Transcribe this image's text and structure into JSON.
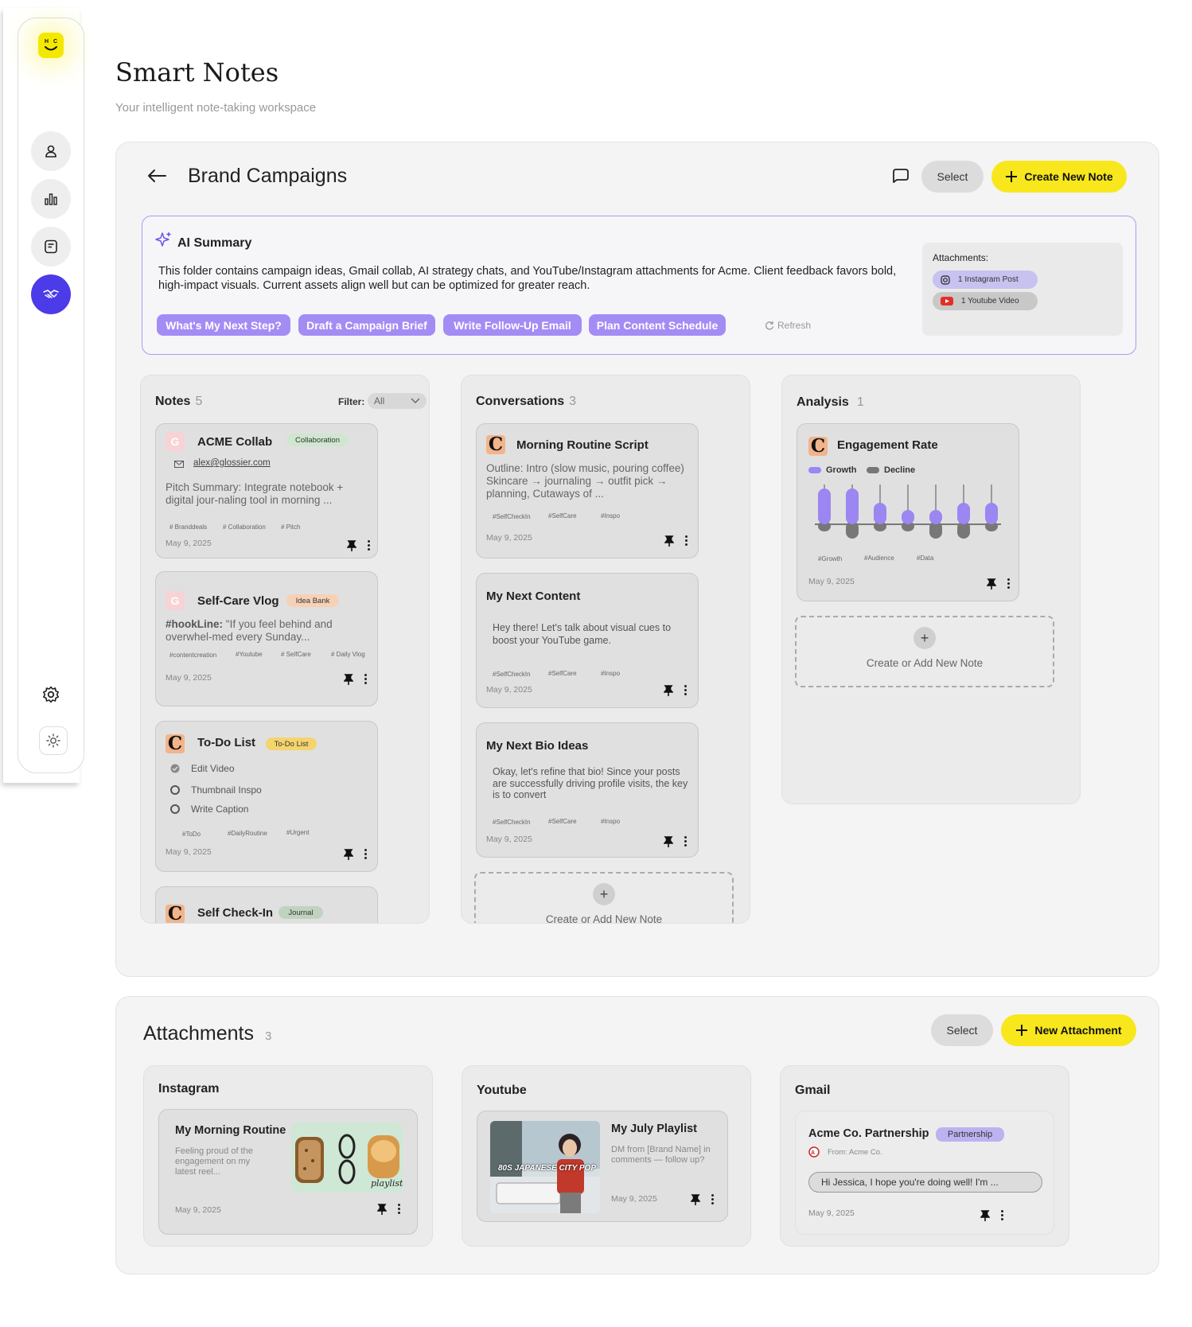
{
  "app": {
    "title": "Smart Notes",
    "subtitle": "Your intelligent note-taking workspace"
  },
  "colors": {
    "accent_yellow": "#f8e71c",
    "accent_purple": "#4b3be8",
    "chip_purple": "#a48cf5"
  },
  "sidebar": {
    "logo_icon": "smiley-logo-icon",
    "items": [
      {
        "icon": "user-icon"
      },
      {
        "icon": "bar-chart-icon"
      },
      {
        "icon": "notes-icon"
      },
      {
        "icon": "handshake-icon",
        "active": true
      }
    ],
    "bottom": [
      {
        "icon": "gear-icon"
      },
      {
        "icon": "sun-icon"
      }
    ]
  },
  "folder": {
    "title": "Brand Campaigns",
    "select_label": "Select",
    "create_label": "Create New Note"
  },
  "ai_summary": {
    "title": "AI Summary",
    "text": "This folder contains campaign ideas, Gmail collab, AI strategy chats, and YouTube/Instagram attachments for Acme. Client feedback favors bold, high-impact visuals. Current assets align well but can be optimized for greater reach.",
    "chips": [
      "What's My Next Step?",
      "Draft a Campaign Brief",
      "Write Follow-Up Email",
      "Plan Content Schedule"
    ],
    "refresh_label": "Refresh",
    "attachments_label": "Attachments:",
    "attachments": [
      "1 Instagram Post",
      "1 Youtube Video"
    ]
  },
  "notes": {
    "title": "Notes",
    "count": "5",
    "filter_label": "Filter:",
    "filter_value": "All",
    "cards": [
      {
        "title": "ACME Collab",
        "tag": "Collaboration",
        "email": "alex@glossier.com",
        "body": "Pitch Summary: Integrate notebook + digital jour-naling tool in morning ...",
        "tags": [
          "# Branddeals",
          "# Collaboration",
          "# Pitch"
        ],
        "date": "May 9, 2025"
      },
      {
        "title": "Self-Care Vlog",
        "tag": "Idea Bank",
        "hook": "#hookLine:",
        "body": "\"If you feel behind and overwhel-med every Sunday...",
        "tags": [
          "#contentcreation",
          "#Youtube",
          "# SelfCare",
          "# Daily Vlog"
        ],
        "date": "May 9, 2025"
      },
      {
        "title": "To-Do List",
        "tag": "To-Do List",
        "todos": [
          "Edit Video",
          "Thumbnail Inspo",
          "Write Caption"
        ],
        "tags": [
          "#ToDo",
          "#DailyRoutine",
          "#Urgent"
        ],
        "date": "May 9, 2025"
      },
      {
        "title": "Self Check-In",
        "tag": "Journal"
      }
    ]
  },
  "conversations": {
    "title": "Conversations",
    "count": "3",
    "cards": [
      {
        "title": "Morning Routine Script",
        "body": "Outline: Intro (slow music, pouring coffee) Skincare → journaling → outfit pick → planning, Cutaways of ...",
        "tags": [
          "#SelfCheckIn",
          "#SelfCare",
          "#Inspo"
        ],
        "date": "May 9, 2025"
      },
      {
        "title": "My Next Content",
        "body": "Hey there! Let's talk about visual cues to boost your YouTube game.",
        "tags": [
          "#SelfCheckIn",
          "#SelfCare",
          "#Inspo"
        ],
        "date": "May 9, 2025"
      },
      {
        "title": "My Next Bio Ideas",
        "body": "Okay, let's refine that bio! Since your posts are successfully driving profile visits, the key is to convert",
        "tags": [
          "#SelfCheckIn",
          "#SelfCare",
          "#Inspo"
        ],
        "date": "May 9, 2025"
      }
    ],
    "add_label": "Create or Add New Note"
  },
  "analysis": {
    "title": "Analysis",
    "count": "1",
    "card": {
      "title": "Engagement Rate",
      "legend": [
        "Growth",
        "Decline"
      ],
      "tags": [
        "#Growth",
        "#Audience",
        "#Data"
      ],
      "date": "May 9, 2025"
    },
    "add_label": "Create or Add New Note"
  },
  "chart_data": {
    "type": "bar",
    "categories": [
      "1",
      "2",
      "3",
      "4",
      "5",
      "6",
      "7"
    ],
    "series": [
      {
        "name": "Growth",
        "values": [
          5,
          5,
          3,
          2,
          2,
          3,
          3
        ]
      },
      {
        "name": "Decline",
        "values": [
          -1,
          -2,
          -1,
          -1,
          -2,
          -2,
          -1
        ]
      }
    ],
    "xlabel": "",
    "ylabel": "",
    "grid": false,
    "legend": "top-left"
  },
  "attachments": {
    "title": "Attachments",
    "count": "3",
    "select_label": "Select",
    "new_label": "New Attachment",
    "instagram": {
      "header": "Instagram",
      "title": "My Morning Routine",
      "body": "Feeling proud of the engagement on my latest reel...",
      "date": "May 9, 2025",
      "thumb_caption": "playlist"
    },
    "youtube": {
      "header": "Youtube",
      "title": "My July Playlist",
      "body": "DM from [Brand Name] in comments — follow up?",
      "date": "May 9, 2025",
      "thumb_caption": "80S JAPANESE CITY POP"
    },
    "gmail": {
      "header": "Gmail",
      "title": "Acme Co. Partnership",
      "tag": "Partnership",
      "from": "From: Acme Co.",
      "preview": "Hi Jessica, I hope you're doing well! I'm ...",
      "date": "May 9, 2025"
    }
  }
}
